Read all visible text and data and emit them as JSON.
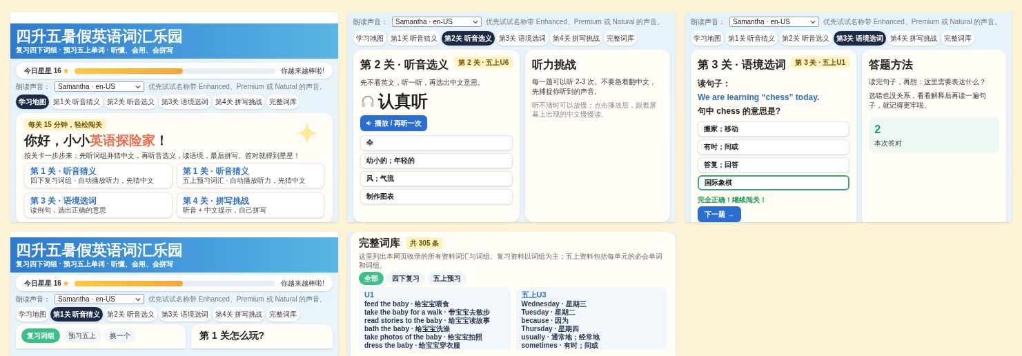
{
  "panels": [
    {
      "kind": "map",
      "header": {
        "title": "四升五暑假英语词汇乐园",
        "subtitle": "复习四下词组 · 预习五上单词 · 听懂、会用、会拼写"
      },
      "progress": {
        "label": "今日星星 16",
        "level": 0.54,
        "message": "你越来越棒啦!"
      },
      "voice": {
        "label": "朗读声音：",
        "value": "Samantha · en-US",
        "hint": "优先试试名称带 Enhanced、Premium 或 Natural 的声音。"
      },
      "tabs": [
        {
          "label": "学习地图",
          "selected": true
        },
        {
          "label": "第1关 听音猜义",
          "selected": false
        },
        {
          "label": "第2关 听音选义",
          "selected": false
        },
        {
          "label": "第3关 语境选词",
          "selected": false
        },
        {
          "label": "第4关 拼写挑战",
          "selected": false
        },
        {
          "label": "完整词库",
          "selected": false
        }
      ],
      "welcome": {
        "badge": "每关 15 分钟，轻松闯关",
        "greeting": "你好，小小",
        "highlight": "英语探险家",
        "greeting_end": "！",
        "intro": "按关卡一步步来：先听词组并猜中文，再听音选义，读语境，最后拼写。答对就得到星星！",
        "levels": [
          {
            "title": "第 1 关 · 听音猜义",
            "desc": "四下复习词组 · 自动播放听力，先猜中文"
          },
          {
            "title": "第 1 关 · 听音猜义",
            "desc": "五上预习词汇 · 自动播放听力，先猜中文"
          },
          {
            "title": "第 3 关 · 语境选词",
            "desc": "读例句，选出正确的意思"
          },
          {
            "title": "第 4 关 · 拼写挑战",
            "desc": "听音 + 中文提示，自己拼写"
          }
        ]
      }
    },
    {
      "kind": "listen",
      "voice": {
        "label": "朗读声音：",
        "value": "Samantha · en-US",
        "hint": "优先试试名称带 Enhanced、Premium 或 Natural 的声音。"
      },
      "tabs": [
        {
          "label": "学习地图",
          "selected": false
        },
        {
          "label": "第1关 听音猜义",
          "selected": false
        },
        {
          "label": "第2关 听音选义",
          "selected": true
        },
        {
          "label": "第3关 语境选词",
          "selected": false
        },
        {
          "label": "第4关 拼写挑战",
          "selected": false
        },
        {
          "label": "完整词库",
          "selected": false
        }
      ],
      "quiz": {
        "title": "第 2 关 · 听音选义",
        "badge": "第 2 关 · 五上U6",
        "prompt": "先不看英文，听一听，再选出中文意思。",
        "cue": "认真听",
        "play_button": "播放 / 再听一次",
        "options": [
          {
            "text": "伞",
            "selected": false
          },
          {
            "text": "幼小的；年轻的",
            "selected": false
          },
          {
            "text": "风；气流",
            "selected": false
          },
          {
            "text": "制作图表",
            "selected": false
          }
        ]
      },
      "side": {
        "title": "听力挑战",
        "lines": [
          "每一题可以听 2-3 次。不要急着翻中文，先捕捉你听到的声音。"
        ],
        "note": "听不清时可以放慢：点击播放后，跟着屏幕上出现的中文慢慢读。"
      }
    },
    {
      "kind": "context",
      "voice": {
        "label": "朗读声音：",
        "value": "Samantha · en-US",
        "hint": "优先试试名称带 Enhanced、Premium 或 Natural 的声音。"
      },
      "tabs": [
        {
          "label": "学习地图",
          "selected": false
        },
        {
          "label": "第1关 听音猜义",
          "selected": false
        },
        {
          "label": "第2关 听音选义",
          "selected": false
        },
        {
          "label": "第3关 语境选词",
          "selected": true
        },
        {
          "label": "第4关 拼写挑战",
          "selected": false
        },
        {
          "label": "完整词库",
          "selected": false
        }
      ],
      "quiz": {
        "title": "第 3 关 · 语境选词",
        "badge": "第 3 关 · 五上U1",
        "lead": "读句子：",
        "sentence": "We are learning “chess” today.",
        "question": "句中 chess 的意思是?",
        "options": [
          {
            "text": "搬家；移动",
            "selected": false
          },
          {
            "text": "有时；间或",
            "selected": false
          },
          {
            "text": "答复；回答",
            "selected": false
          },
          {
            "text": "国际象棋",
            "selected": true
          }
        ],
        "feedback": "完全正确！继续闯关！",
        "next_button": "下一题 →"
      },
      "side": {
        "title": "答题方法",
        "lines": [
          "读完句子，再想：这里需要表达什么？",
          "选错也没关系，看看解释后再读一遍句子，就记得更牢啦。"
        ],
        "stat": {
          "value": "2",
          "label": "本次答对"
        }
      }
    },
    {
      "kind": "guess",
      "header": {
        "title": "四升五暑假英语词汇乐园",
        "subtitle": "复习四下词组 · 预习五上单词 · 听懂、会用、会拼写"
      },
      "progress": {
        "label": "今日星星 16",
        "level": 0.54,
        "message": "你越来越棒啦!"
      },
      "voice": {
        "label": "朗读声音：",
        "value": "Samantha · en-US",
        "hint": "优先试试名称带 Enhanced、Premium 或 Natural 的声音。"
      },
      "tabs": [
        {
          "label": "学习地图",
          "selected": false
        },
        {
          "label": "第1关 听音猜义",
          "selected": true
        },
        {
          "label": "第2关 听音选义",
          "selected": false
        },
        {
          "label": "第3关 语境选词",
          "selected": false
        },
        {
          "label": "第4关 拼写挑战",
          "selected": false
        },
        {
          "label": "完整词库",
          "selected": false
        }
      ],
      "modes": [
        {
          "label": "复习词组",
          "selected": true
        },
        {
          "label": "预习五上",
          "selected": false
        },
        {
          "label": "换一个",
          "selected": false
        }
      ],
      "side": {
        "title": "第 1 关怎么玩?"
      }
    },
    {
      "kind": "library",
      "title": "完整词库",
      "count": "共 305 条",
      "description": "这里列出本网页收录的所有资料词汇与词组。复习资料以词组为主；五上资料包括每单元的必会单词和词组。",
      "filters": [
        {
          "label": "全部",
          "selected": true
        },
        {
          "label": "四下复习",
          "selected": false
        },
        {
          "label": "五上预习",
          "selected": false
        }
      ],
      "groups": [
        {
          "title": "U1",
          "entries": [
            "feed the baby · 给宝宝喂食",
            "take the baby for a walk · 带宝宝去散步",
            "read stories to the baby · 给宝宝读故事",
            "bath the baby · 给宝宝洗澡",
            "take photos of the baby · 给宝宝拍照",
            "dress the baby · 给宝宝穿衣服"
          ]
        },
        {
          "title": "五上U3",
          "entries": [
            "Wednesday · 星期三",
            "Tuesday · 星期二",
            "because · 因为",
            "Thursday · 星期四",
            "usually · 通常地；经常地",
            "sometimes · 有时；间或"
          ]
        }
      ]
    }
  ]
}
